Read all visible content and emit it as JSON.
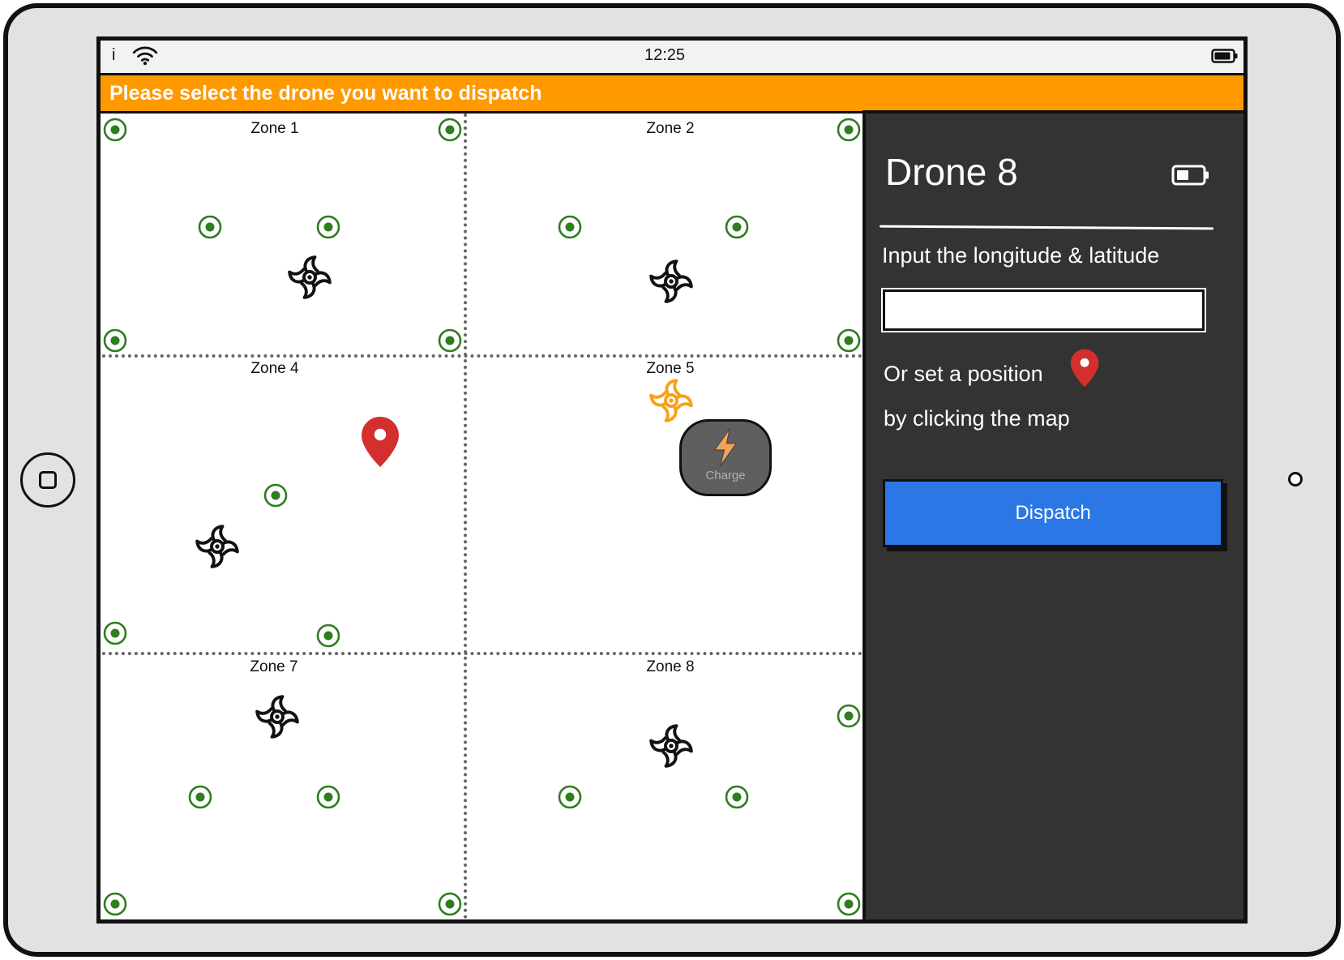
{
  "status_bar": {
    "carrier": "i",
    "time": "12:25",
    "wifi_icon": "wifi-icon",
    "battery_icon": "battery-icon"
  },
  "banner": {
    "text": "Please select the drone you want to dispatch"
  },
  "map": {
    "zones": [
      {
        "label": "Zone 1"
      },
      {
        "label": "Zone 2"
      },
      {
        "label": "Zone 4"
      },
      {
        "label": "Zone 5"
      },
      {
        "label": "Zone 7"
      },
      {
        "label": "Zone 8"
      }
    ],
    "drone_icon": "drone-icon",
    "station_icon": "target-icon",
    "pin_icon": "map-pin-icon",
    "charge_button": {
      "label": "Charge",
      "icon": "lightning-icon"
    }
  },
  "panel": {
    "title": "Drone 8",
    "battery_icon": "battery-icon",
    "input_label": "Input the longitude & latitude",
    "input_value": "",
    "position_hint_line1": "Or set a position",
    "position_hint_icon": "map-pin-icon",
    "position_hint_line2": "by clicking the map",
    "dispatch_label": "Dispatch"
  },
  "colors": {
    "banner": "#ff9900",
    "dispatch": "#2c77e6",
    "panel": "#333333",
    "station": "#2e7d1f",
    "pin": "#d32f2f",
    "selected": "#f7a21b",
    "bolt": "#f4a259"
  }
}
